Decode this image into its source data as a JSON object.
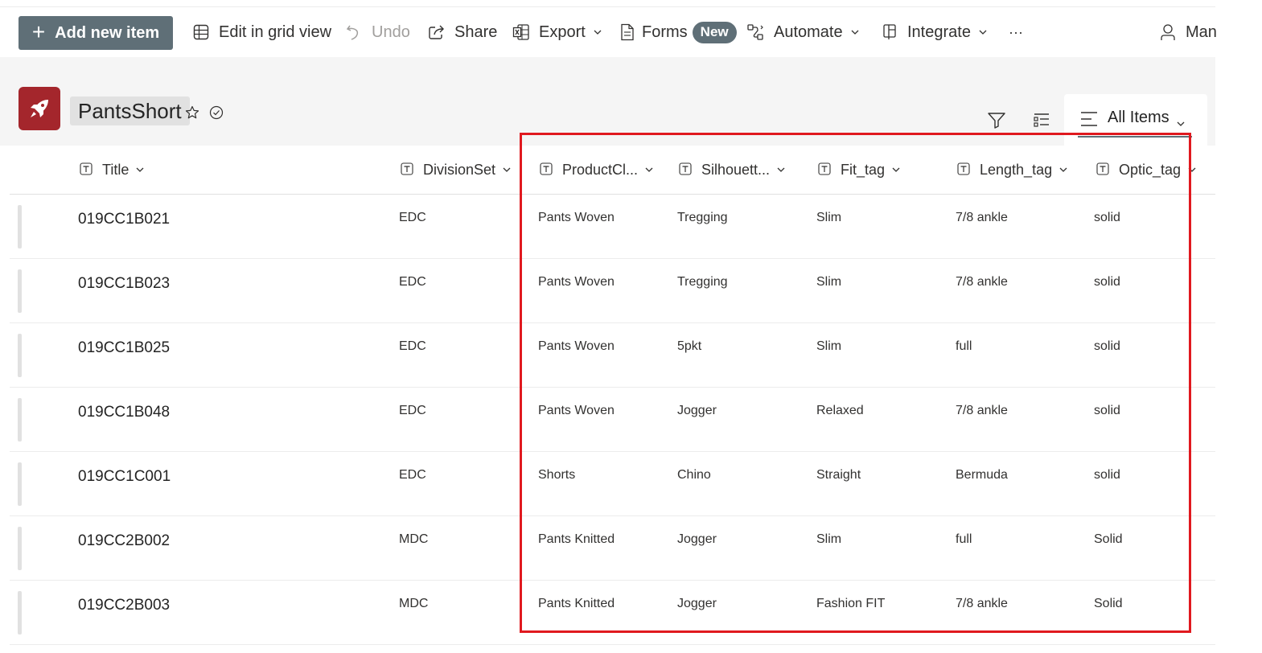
{
  "toolbar": {
    "add_label": "Add new item",
    "edit_grid_label": "Edit in grid view",
    "undo_label": "Undo",
    "share_label": "Share",
    "export_label": "Export",
    "forms_label": "Forms",
    "forms_badge": "New",
    "automate_label": "Automate",
    "integrate_label": "Integrate",
    "more_label": "···",
    "user_label": "Man"
  },
  "list": {
    "title": "PantsShort",
    "view_name": "All Items",
    "icon_color": "#a4262c"
  },
  "columns": [
    "Title",
    "DivisionSet",
    "ProductCl...",
    "Silhouett...",
    "Fit_tag",
    "Length_tag",
    "Optic_tag"
  ],
  "rows": [
    [
      "019CC1B021",
      "EDC",
      "Pants Woven",
      "Tregging",
      "Slim",
      "7/8 ankle",
      "solid"
    ],
    [
      "019CC1B023",
      "EDC",
      "Pants Woven",
      "Tregging",
      "Slim",
      "7/8 ankle",
      "solid"
    ],
    [
      "019CC1B025",
      "EDC",
      "Pants Woven",
      "5pkt",
      "Slim",
      "full",
      "solid"
    ],
    [
      "019CC1B048",
      "EDC",
      "Pants Woven",
      "Jogger",
      "Relaxed",
      "7/8 ankle",
      "solid"
    ],
    [
      "019CC1C001",
      "EDC",
      "Shorts",
      "Chino",
      "Straight",
      "Bermuda",
      "solid"
    ],
    [
      "019CC2B002",
      "MDC",
      "Pants Knitted",
      "Jogger",
      "Slim",
      "full",
      "Solid"
    ],
    [
      "019CC2B003",
      "MDC",
      "Pants Knitted",
      "Jogger",
      "Fashion FIT",
      "7/8 ankle",
      "Solid"
    ]
  ],
  "colors": {
    "accent": "#5f6f77",
    "highlight": "#e0191f"
  }
}
